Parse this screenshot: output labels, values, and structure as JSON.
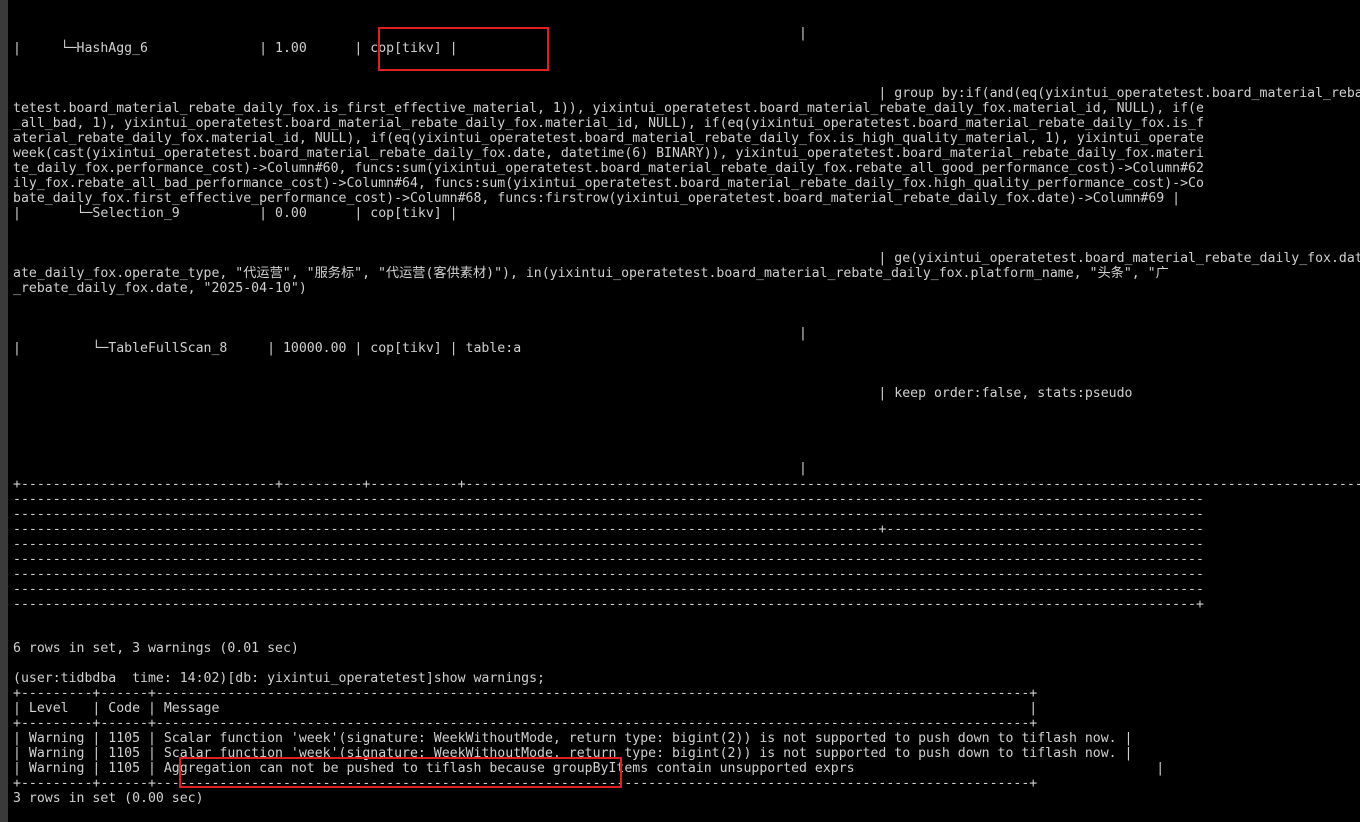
{
  "terminal": {
    "lines": [
      "                                                                                                   |",
      "|     └─HashAgg_6              | 1.00      | cop[tikv] |",
      "",
      "",
      "                                                                                                             | group by:if(and(eq(yixintui_operatetest.board_material_rebate_",
      "tetest.board_material_rebate_daily_fox.is_first_effective_material, 1)), yixintui_operatetest.board_material_rebate_daily_fox.material_id, NULL), if(e",
      "_all_bad, 1), yixintui_operatetest.board_material_rebate_daily_fox.material_id, NULL), if(eq(yixintui_operatetest.board_material_rebate_daily_fox.is_f",
      "aterial_rebate_daily_fox.material_id, NULL), if(eq(yixintui_operatetest.board_material_rebate_daily_fox.is_high_quality_material, 1), yixintui_operate",
      "week(cast(yixintui_operatetest.board_material_rebate_daily_fox.date, datetime(6) BINARY)), yixintui_operatetest.board_material_rebate_daily_fox.materi",
      "te_daily_fox.performance_cost)->Column#60, funcs:sum(yixintui_operatetest.board_material_rebate_daily_fox.rebate_all_good_performance_cost)->Column#62",
      "ily_fox.rebate_all_bad_performance_cost)->Column#64, funcs:sum(yixintui_operatetest.board_material_rebate_daily_fox.high_quality_performance_cost)->Co",
      "bate_daily_fox.first_effective_performance_cost)->Column#68, funcs:firstrow(yixintui_operatetest.board_material_rebate_daily_fox.date)->Column#69 |",
      "|       └─Selection_9          | 0.00      | cop[tikv] |",
      "",
      "",
      "                                                                                                             | ge(yixintui_operatetest.board_material_rebate_daily_fox.date,",
      "ate_daily_fox.operate_type, \"代运营\", \"服务标\", \"代运营(客供素材)\"), in(yixintui_operatetest.board_material_rebate_daily_fox.platform_name, \"头条\", \"广",
      "_rebate_daily_fox.date, \"2025-04-10\")",
      "",
      "",
      "",
      "                                                                                                   |",
      "|         └─TableFullScan_8     | 10000.00 | cop[tikv] | table:a",
      "",
      "",
      "                                                                                                             | keep order:false, stats:pseudo",
      "",
      "",
      "",
      "",
      "",
      "                                                                                                   |",
      "+--------------------------------+----------+-----------+----------------------------------------------------------------------------------------------------------------------",
      "------------------------------------------------------------------------------------------------------------------------------------------------------",
      "------------------------------------------------------------------------------------------------------------------------------------------------------",
      "-------------------------------------------------------------------------------------------------------------+----------------------------------------",
      "------------------------------------------------------------------------------------------------------------------------------------------------------",
      "------------------------------------------------------------------------------------------------------------------------------------------------------",
      "------------------------------------------------------------------------------------------------------------------------------------------------------",
      "------------------------------------------------------------------------------------------------------------------------------------------------------",
      "-----------------------------------------------------------------------------------------------------------------------------------------------------+",
      "6 rows in set, 3 warnings (0.01 sec)",
      "",
      "(user:tidbdba  time: 14:02)[db: yixintui_operatetest]show warnings;",
      "+---------+------+--------------------------------------------------------------------------------------------------------------+",
      "| Level   | Code | Message                                                                                                      |",
      "+---------+------+--------------------------------------------------------------------------------------------------------------+",
      "| Warning | 1105 | Scalar function 'week'(signature: WeekWithoutMode, return type: bigint(2)) is not supported to push down to tiflash now. |",
      "| Warning | 1105 | Scalar function 'week'(signature: WeekWithoutMode, return type: bigint(2)) is not supported to push down to tiflash now. |",
      "| Warning | 1105 | Aggregation can not be pushed to tiflash because groupByItems contain unsupported exprs                                      |",
      "+---------+------+--------------------------------------------------------------------------------------------------------------+",
      "3 rows in set (0.00 sec)"
    ]
  }
}
